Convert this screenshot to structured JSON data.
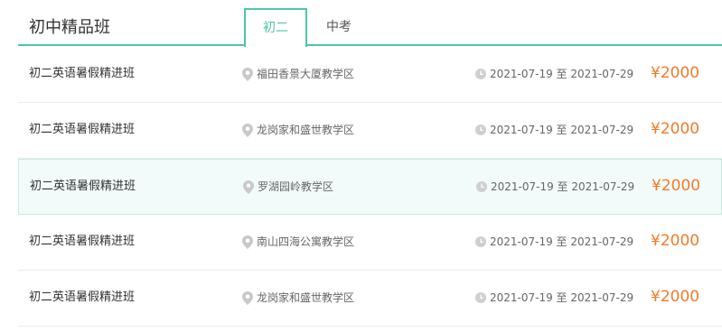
{
  "header": {
    "title": "初中精品班",
    "tabs": [
      {
        "label": "初二",
        "active": true
      },
      {
        "label": "中考",
        "active": false
      }
    ]
  },
  "colors": {
    "accent": "#4cc6a9",
    "price": "#f07b2a",
    "highlight_bg": "#f3fbfa"
  },
  "courses": [
    {
      "name": "初二英语暑假精进班",
      "location": "福田香景大厦教学区",
      "date": "2021-07-19 至 2021-07-29",
      "price": "¥2000",
      "icon_location": "location-pin-icon",
      "icon_date": "clock-icon"
    },
    {
      "name": "初二英语暑假精进班",
      "location": "龙岗家和盛世教学区",
      "date": "2021-07-19 至 2021-07-29",
      "price": "¥2000",
      "icon_location": "location-pin-icon",
      "icon_date": "clock-icon"
    },
    {
      "name": "初二英语暑假精进班",
      "location": "罗湖园岭教学区",
      "date": "2021-07-19 至 2021-07-29",
      "price": "¥2000",
      "highlighted": true,
      "icon_location": "location-pin-icon",
      "icon_date": "clock-icon"
    },
    {
      "name": "初二英语暑假精进班",
      "location": "南山四海公寓教学区",
      "date": "2021-07-19 至 2021-07-29",
      "price": "¥2000",
      "icon_location": "location-pin-icon",
      "icon_date": "clock-icon"
    },
    {
      "name": "初二英语暑假精进班",
      "location": "龙岗家和盛世教学区",
      "date": "2021-07-19 至 2021-07-29",
      "price": "¥2000",
      "icon_location": "location-pin-icon",
      "icon_date": "clock-icon"
    }
  ]
}
